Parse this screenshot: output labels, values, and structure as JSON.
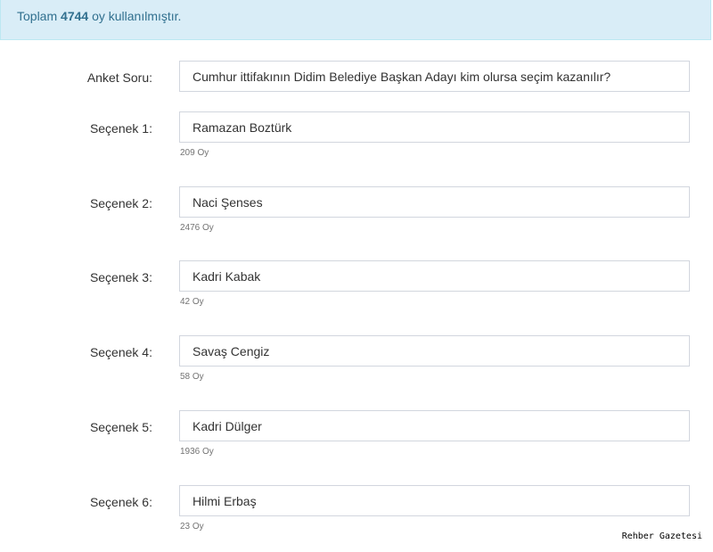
{
  "alert": {
    "prefix": "Toplam",
    "total": "4744",
    "suffix": "oy kullanılmıştır."
  },
  "question": {
    "label": "Anket Soru:",
    "value": "Cumhur ittifakının Didim Belediye Başkan Adayı kim olursa seçim kazanılır?"
  },
  "options": [
    {
      "label": "Seçenek 1:",
      "value": "Ramazan Boztürk",
      "votes": "209 Oy"
    },
    {
      "label": "Seçenek 2:",
      "value": "Naci Şenses",
      "votes": "2476 Oy"
    },
    {
      "label": "Seçenek 3:",
      "value": "Kadri Kabak",
      "votes": "42 Oy"
    },
    {
      "label": "Seçenek 4:",
      "value": "Savaş Cengiz",
      "votes": "58 Oy"
    },
    {
      "label": "Seçenek 5:",
      "value": "Kadri Dülger",
      "votes": "1936 Oy"
    },
    {
      "label": "Seçenek 6:",
      "value": "Hilmi Erbaş",
      "votes": "23 Oy"
    }
  ],
  "watermark": "Rehber Gazetesi"
}
